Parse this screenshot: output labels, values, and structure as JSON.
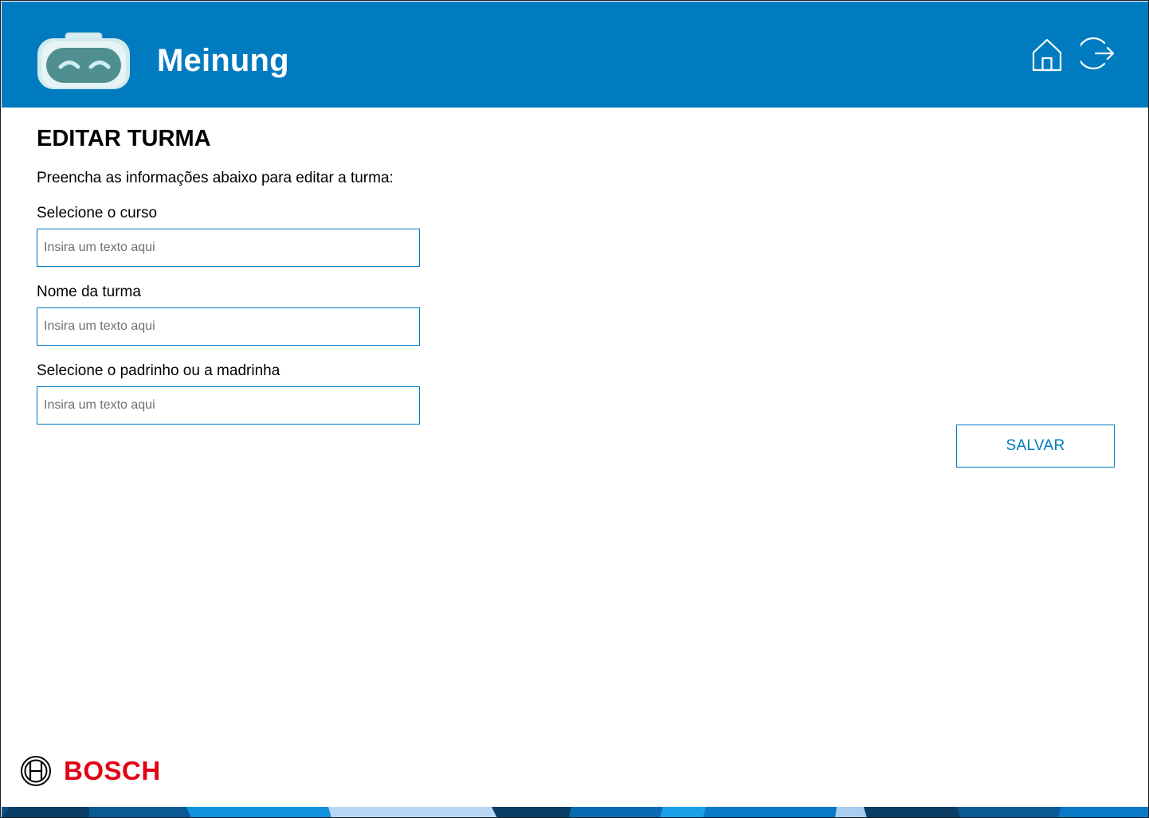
{
  "header": {
    "app_title": "Meinung",
    "logo_icon": "robot-mask-icon",
    "home_icon": "home-icon",
    "logout_icon": "logout-icon",
    "background_color": "#007bc0"
  },
  "main": {
    "page_title": "EDITAR TURMA",
    "instructions": "Preencha as informações abaixo para editar a turma:",
    "fields": [
      {
        "label": "Selecione o curso",
        "value": "",
        "placeholder": "Insira um texto aqui"
      },
      {
        "label": "Nome da turma",
        "value": "",
        "placeholder": "Insira um texto aqui"
      },
      {
        "label": "Selecione o padrinho ou a madrinha",
        "value": "",
        "placeholder": "Insira um texto aqui"
      }
    ],
    "save_label": "SALVAR"
  },
  "footer": {
    "brand_icon": "bosch-armature-icon",
    "brand_name": "BOSCH",
    "brand_color": "#e20015"
  }
}
